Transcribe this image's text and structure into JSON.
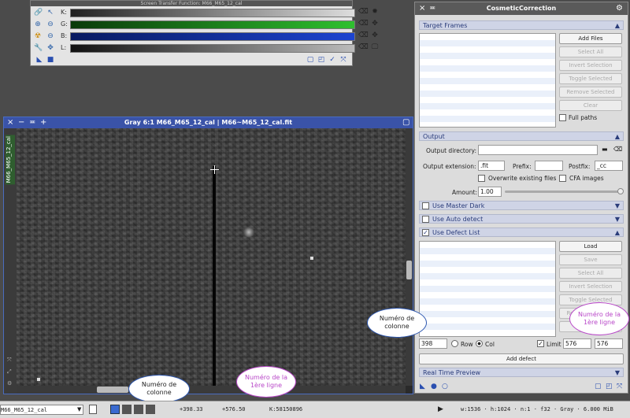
{
  "stf": {
    "title": "Screen Transfer Function: M66_M65_12_cal",
    "channels": [
      {
        "label": "K:",
        "color": "#6a6a6a"
      },
      {
        "label": "G:",
        "color": "#1e9a1e"
      },
      {
        "label": "B:",
        "color": "#1633a6"
      },
      {
        "label": "L:",
        "color": "#3a3a3a"
      }
    ]
  },
  "image_window": {
    "title": "Gray 6:1 M66_M65_12_cal | M66~M65_12_cal.fit",
    "side_tab": "M66_M65_12_cal"
  },
  "cosmetic": {
    "title": "CosmeticCorrection",
    "target_frames": {
      "header": "Target Frames",
      "buttons": [
        "Add Files",
        "Select All",
        "Invert Selection",
        "Toggle Selected",
        "Remove Selected",
        "Clear"
      ],
      "full_paths": "Full paths"
    },
    "output": {
      "header": "Output",
      "directory_label": "Output directory:",
      "directory_value": "",
      "extension_label": "Output extension:",
      "extension_value": ".fit",
      "prefix_label": "Prefix:",
      "prefix_value": "",
      "postfix_label": "Postfix:",
      "postfix_value": "_cc",
      "overwrite_label": "Overwrite existing files",
      "cfa_label": "CFA images",
      "amount_label": "Amount:",
      "amount_value": "1.00"
    },
    "use_master_dark": "Use Master Dark",
    "use_auto_detect": "Use Auto detect",
    "defect_list": {
      "header": "Use Defect List",
      "buttons": [
        "Load",
        "Save",
        "Select All",
        "Invert Selection",
        "Toggle Selected",
        "Remove Selected",
        "Clear"
      ],
      "coord_value": "398",
      "row_label": "Row",
      "col_label": "Col",
      "limit_label": "Limit",
      "limit_from": "576",
      "limit_to": "576",
      "add_defect": "Add defect"
    },
    "real_time_preview": "Real Time Preview"
  },
  "callouts": {
    "col_top": "Numéro de colonne",
    "row_top": "Numéro de la 1ère ligne",
    "col_bottom": "Numéro de colonne",
    "row_bottom": "Numéro de la 1ère ligne"
  },
  "status": {
    "view_name": "M66_M65_12_cal",
    "x": "+398.33",
    "y": "+576.50",
    "k": "K:58150896",
    "info": "w:1536 · h:1024 · n:1 · f32 · Gray · 6.000 MiB"
  },
  "colors": {
    "accent": "#3a53a8",
    "callout_blue": "#2c56b0",
    "callout_purple": "#b847c8"
  }
}
